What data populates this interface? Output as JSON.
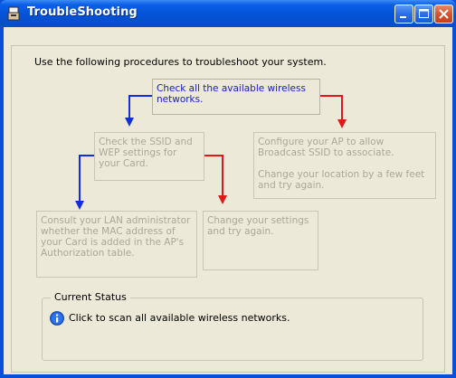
{
  "window": {
    "title": "TroubleShooting",
    "icon": "wireless-adapter-icon",
    "controls": [
      "minimize-icon",
      "maximize-icon",
      "close-icon"
    ]
  },
  "intro_text": "Use the following procedures to troubleshoot your system.",
  "steps": {
    "check_networks": "Check all the available wireless networks.",
    "check_ssid": "Check the SSID and WEP settings for your Card.",
    "configure_ap": "Configure your AP to allow Broadcast SSID to associate.",
    "change_location": "Change your location by a few feet and try again.",
    "consult_admin": "Consult your LAN administrator whether the MAC address of your Card is added in the AP's Authorization table.",
    "change_settings": "Change your settings and try again."
  },
  "status": {
    "legend": "Current Status",
    "icon": "info-icon",
    "message": "Click to scan all available wireless networks."
  },
  "colors": {
    "active_step_text": "#1a1acc",
    "inactive_step_text": "#aca899",
    "yes_arrow": "#1030e0",
    "no_arrow": "#e01818"
  }
}
